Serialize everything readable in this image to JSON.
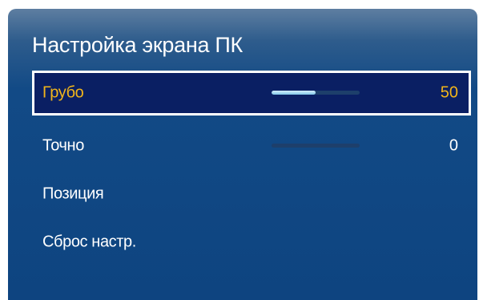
{
  "menu": {
    "title": "Настройка экрана ПК",
    "items": [
      {
        "label": "Грубо",
        "value": "50",
        "progress": 0.5,
        "selected": true
      },
      {
        "label": "Точно",
        "value": "0",
        "progress": 0.0,
        "selected": false
      },
      {
        "label": "Позиция"
      },
      {
        "label": "Сброс настр."
      }
    ]
  },
  "colors": {
    "highlight_text": "#f2b51a",
    "selected_background": "#0a1f63",
    "panel_background": "#124a86",
    "slider_fill": "#a6dcf2"
  }
}
